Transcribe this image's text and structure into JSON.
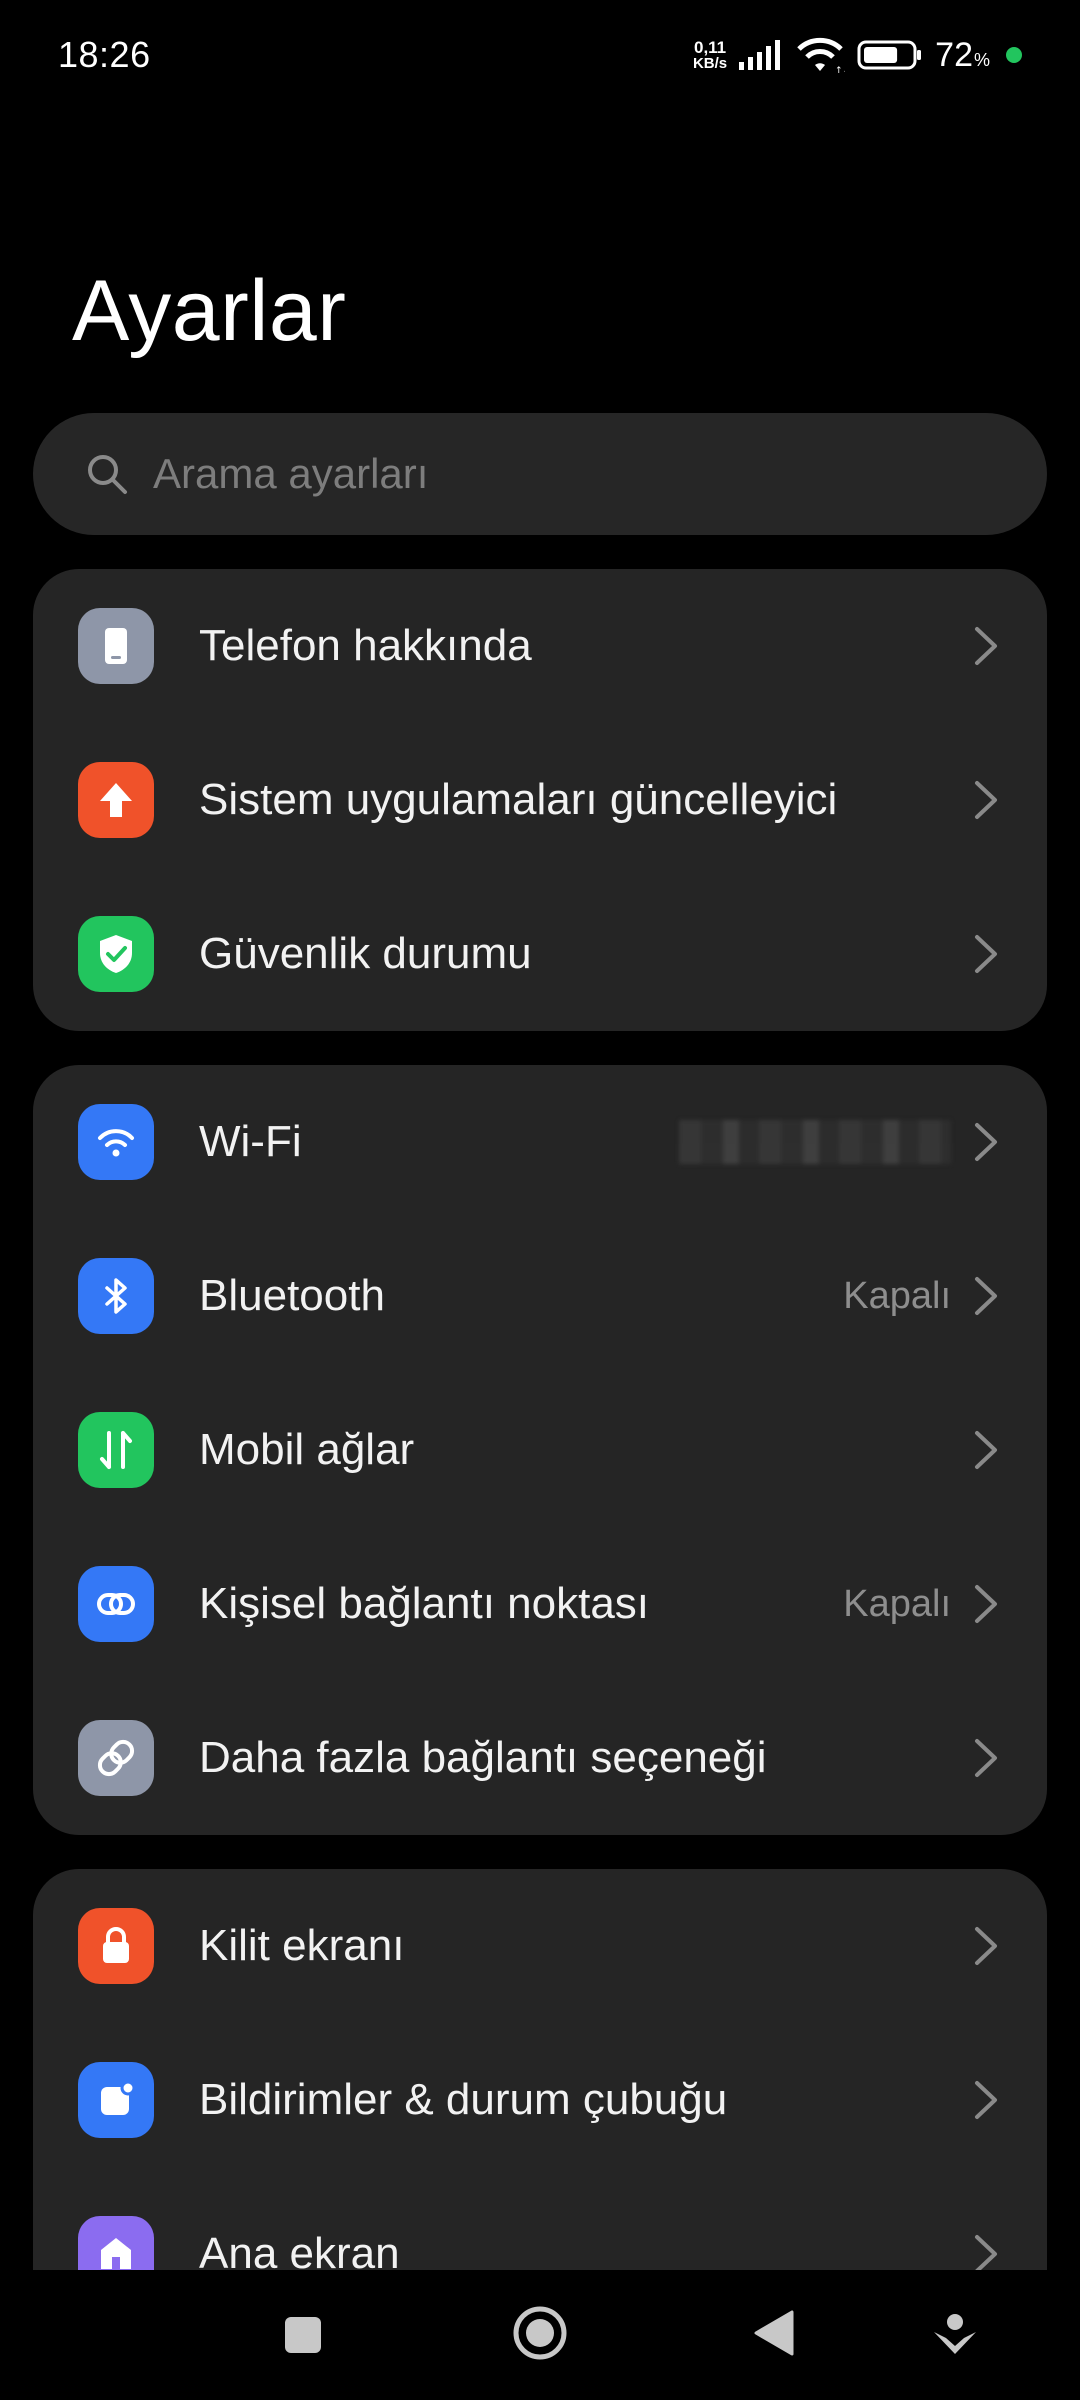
{
  "status_bar": {
    "time": "18:26",
    "net_speed_value": "0,11",
    "net_speed_unit": "KB/s",
    "battery_percent": "72",
    "battery_unit": "%",
    "battery_level": 0.72,
    "accent_dot_color": "#22c55e"
  },
  "header": {
    "title": "Ayarlar"
  },
  "search": {
    "placeholder": "Arama ayarları",
    "icon": "search-icon"
  },
  "groups": [
    {
      "items": [
        {
          "label": "Telefon hakkında",
          "icon": "phone-icon",
          "icon_color": "#8e96a8",
          "value": ""
        },
        {
          "label": "Sistem uygulamaları güncelleyici",
          "icon": "arrow-up-icon",
          "icon_color": "#f0522a",
          "value": ""
        },
        {
          "label": "Güvenlik durumu",
          "icon": "shield-check-icon",
          "icon_color": "#22c55e",
          "value": ""
        }
      ]
    },
    {
      "items": [
        {
          "label": "Wi-Fi",
          "icon": "wifi-icon",
          "icon_color": "#3478f6",
          "value": ""
        },
        {
          "label": "Bluetooth",
          "icon": "bluetooth-icon",
          "icon_color": "#3478f6",
          "value": "Kapalı"
        },
        {
          "label": "Mobil ağlar",
          "icon": "mobile-data-icon",
          "icon_color": "#22c55e",
          "value": ""
        },
        {
          "label": "Kişisel bağlantı noktası",
          "icon": "hotspot-link-icon",
          "icon_color": "#3478f6",
          "value": "Kapalı"
        },
        {
          "label": "Daha fazla bağlantı seçeneği",
          "icon": "link-icon",
          "icon_color": "#8e96a8",
          "value": ""
        }
      ]
    },
    {
      "items": [
        {
          "label": "Kilit ekranı",
          "icon": "lock-icon",
          "icon_color": "#f0522a",
          "value": ""
        },
        {
          "label": "Bildirimler & durum çubuğu",
          "icon": "notification-icon",
          "icon_color": "#3478f6",
          "value": ""
        },
        {
          "label": "Ana ekran",
          "icon": "home-icon",
          "icon_color": "#8b6cf0",
          "value": ""
        }
      ]
    }
  ],
  "nav_bar": {
    "buttons": [
      "recent-apps-icon",
      "home-button-icon",
      "back-icon",
      "assistant-icon"
    ]
  }
}
